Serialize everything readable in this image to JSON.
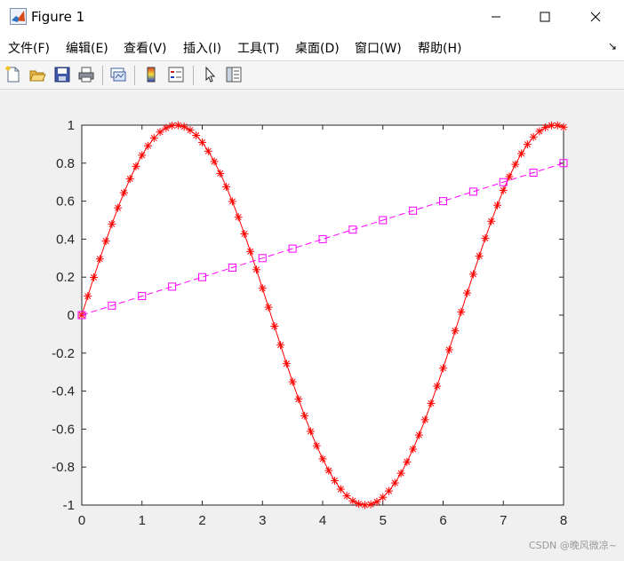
{
  "window": {
    "title": "Figure 1"
  },
  "menu": [
    "文件(F)",
    "编辑(E)",
    "查看(V)",
    "插入(I)",
    "工具(T)",
    "桌面(D)",
    "窗口(W)",
    "帮助(H)"
  ],
  "toolbar": [
    "new-figure-icon",
    "open-file-icon",
    "save-icon",
    "print-icon",
    "link-plot-icon",
    "colorbar-icon",
    "legend-icon",
    "pointer-icon",
    "property-editor-icon"
  ],
  "watermark": "CSDN @晚风微凉~",
  "chart_data": {
    "type": "line",
    "xlim": [
      0,
      8
    ],
    "ylim": [
      -1,
      1
    ],
    "xticks": [
      "0",
      "1",
      "2",
      "3",
      "4",
      "5",
      "6",
      "7",
      "8"
    ],
    "yticks": [
      "1",
      "0.8",
      "0.6",
      "0.4",
      "0.2",
      "0",
      "-0.2",
      "-0.4",
      "-0.6",
      "-0.8",
      "-1"
    ],
    "grid": false,
    "series": [
      {
        "label_hint": "sin",
        "color": "#ff0000",
        "line": "solid",
        "marker": "*",
        "x_start": 0,
        "x_end": 8,
        "x_step": 0.1,
        "function": "sin(x)"
      },
      {
        "label_hint": "linear",
        "color": "#ff00ff",
        "line": "dashed",
        "marker": "square",
        "x": [
          0,
          0.5,
          1,
          1.5,
          2,
          2.5,
          3,
          3.5,
          4,
          4.5,
          5,
          5.5,
          6,
          6.5,
          7,
          7.5,
          8
        ],
        "y": [
          0,
          0.05,
          0.1,
          0.15,
          0.2,
          0.25,
          0.3,
          0.35,
          0.4,
          0.45,
          0.5,
          0.55,
          0.6,
          0.65,
          0.7,
          0.75,
          0.8
        ]
      }
    ]
  }
}
